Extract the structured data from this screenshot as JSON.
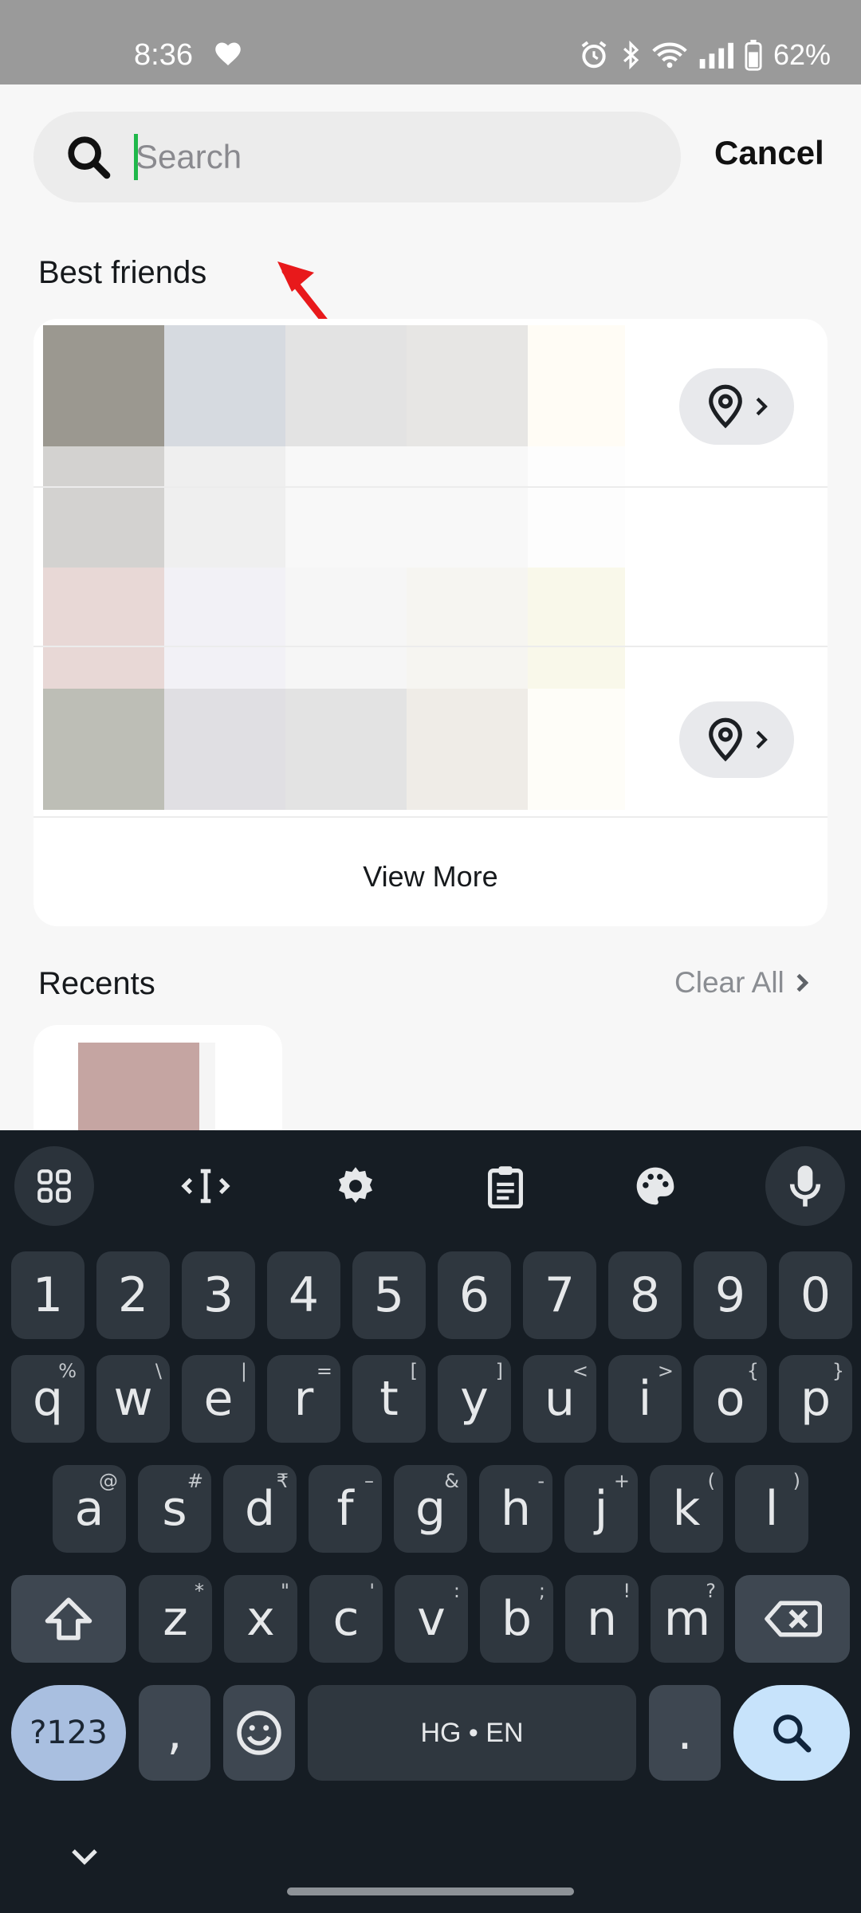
{
  "status_bar": {
    "time": "8:36",
    "battery": "62%",
    "icons": [
      "heart-icon",
      "alarm-icon",
      "bluetooth-icon",
      "wifi-icon",
      "signal-icon",
      "battery-icon"
    ]
  },
  "search": {
    "placeholder": "Search",
    "value": "",
    "cancel_label": "Cancel"
  },
  "best_friends": {
    "title": "Best friends",
    "view_more_label": "View More"
  },
  "recents": {
    "title": "Recents",
    "clear_all_label": "Clear All"
  },
  "keyboard": {
    "toolbar_icons": [
      "apps-grid-icon",
      "text-cursor-icon",
      "settings-icon",
      "clipboard-icon",
      "palette-icon",
      "microphone-icon"
    ],
    "number_row": [
      "1",
      "2",
      "3",
      "4",
      "5",
      "6",
      "7",
      "8",
      "9",
      "0"
    ],
    "row1": [
      {
        "k": "q",
        "h": "%"
      },
      {
        "k": "w",
        "h": "\\"
      },
      {
        "k": "e",
        "h": "|"
      },
      {
        "k": "r",
        "h": "="
      },
      {
        "k": "t",
        "h": "["
      },
      {
        "k": "y",
        "h": "]"
      },
      {
        "k": "u",
        "h": "<"
      },
      {
        "k": "i",
        "h": ">"
      },
      {
        "k": "o",
        "h": "{"
      },
      {
        "k": "p",
        "h": "}"
      }
    ],
    "row2": [
      {
        "k": "a",
        "h": "@"
      },
      {
        "k": "s",
        "h": "#"
      },
      {
        "k": "d",
        "h": "₹"
      },
      {
        "k": "f",
        "h": "–"
      },
      {
        "k": "g",
        "h": "&"
      },
      {
        "k": "h",
        "h": "-"
      },
      {
        "k": "j",
        "h": "+"
      },
      {
        "k": "k",
        "h": "("
      },
      {
        "k": "l",
        "h": ")"
      }
    ],
    "row3": [
      {
        "k": "z",
        "h": "*"
      },
      {
        "k": "x",
        "h": "\""
      },
      {
        "k": "c",
        "h": "'"
      },
      {
        "k": "v",
        "h": ":"
      },
      {
        "k": "b",
        "h": ";"
      },
      {
        "k": "n",
        "h": "!"
      },
      {
        "k": "m",
        "h": "?"
      }
    ],
    "symbols_label": "?123",
    "comma_label": ",",
    "space_label": "HG • EN",
    "period_label": "."
  },
  "colors": {
    "status_bar_bg": "#9a9a9a",
    "keyboard_bg": "#161d24",
    "key_bg": "#2f373f",
    "enter_key_bg": "#c7e3fb",
    "annotation_arrow": "#e8191b"
  }
}
